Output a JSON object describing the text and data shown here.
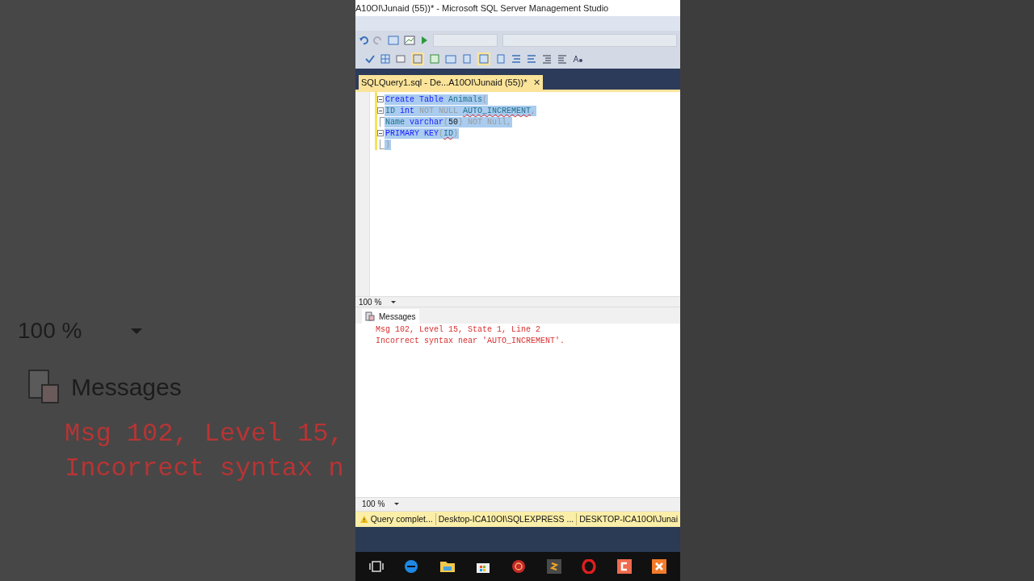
{
  "backdrop": {
    "zoom": "100 %",
    "tab": "Messages",
    "lines": [
      "Msg 102, Level 15,",
      "Incorrect syntax n"
    ]
  },
  "window": {
    "title": "A10OI\\Junaid (55))* - Microsoft SQL Server Management Studio"
  },
  "document_tab": {
    "label": "SQLQuery1.sql - De...A10OI\\Junaid (55))*",
    "close": "✕",
    "selected": true
  },
  "editor": {
    "lines": [
      {
        "kind": "open",
        "selected": true,
        "tokens": [
          {
            "text": "Create Table",
            "kind": "keyword"
          },
          {
            "text": " Animals",
            "kind": "ident"
          },
          {
            "text": "(",
            "kind": "muted"
          }
        ]
      },
      {
        "kind": "open",
        "selected": true,
        "tokens": [
          {
            "text": "ID",
            "kind": "ident"
          },
          {
            "text": " int",
            "kind": "keyword"
          },
          {
            "text": " NOT NULL ",
            "kind": "muted"
          },
          {
            "text": "AUTO_INCREMENT",
            "kind": "error"
          },
          {
            "text": ",",
            "kind": "muted"
          }
        ]
      },
      {
        "kind": "line",
        "selected": true,
        "tokens": [
          {
            "text": "Name",
            "kind": "ident"
          },
          {
            "text": " varchar",
            "kind": "keyword"
          },
          {
            "text": "(",
            "kind": "muted"
          },
          {
            "text": "50",
            "kind": "number"
          },
          {
            "text": ")",
            "kind": "muted"
          },
          {
            "text": " NOT Null,",
            "kind": "muted"
          }
        ]
      },
      {
        "kind": "open",
        "selected": true,
        "tokens": [
          {
            "text": "PRIMARY KEY",
            "kind": "keyword"
          },
          {
            "text": "(",
            "kind": "muted"
          },
          {
            "text": "ID",
            "kind": "error"
          },
          {
            "text": ")",
            "kind": "muted"
          }
        ]
      },
      {
        "kind": "end",
        "selected": true,
        "tokens": [
          {
            "text": ")",
            "kind": "muted"
          }
        ]
      }
    ],
    "zoom": "100 %"
  },
  "results": {
    "tab": "Messages",
    "messages": [
      "Msg 102, Level 15, State 1, Line 2",
      "Incorrect syntax near 'AUTO_INCREMENT'."
    ],
    "zoom": "100 %"
  },
  "status_bar": {
    "items": [
      "Query complet...",
      "Desktop-ICA10OI\\SQLEXPRESS ...",
      "DESKTOP-ICA10OI\\Junai"
    ]
  }
}
